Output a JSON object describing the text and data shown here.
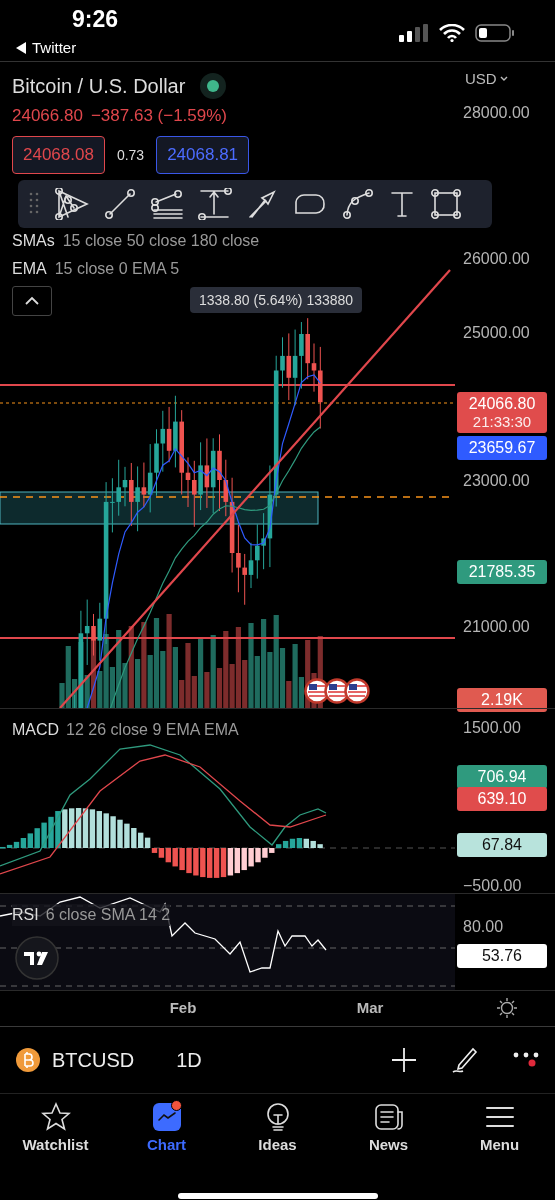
{
  "status_bar": {
    "time": "9:26",
    "back_label": "Twitter"
  },
  "symbol_header": {
    "title": "Bitcoin / U.S. Dollar",
    "last_price": "24066.80",
    "change": "−387.63 (−1.59%)",
    "bid": "24068.08",
    "spread": "0.73",
    "ask": "24068.81"
  },
  "indicators": [
    {
      "name": "SMAs",
      "params": "15 close 50 close 180 close"
    },
    {
      "name": "EMA",
      "params": "15 close 0 EMA 5"
    }
  ],
  "measure_tooltip": "1338.80 (5.64%) 133880",
  "price_axis": {
    "currency": "USD",
    "labels": [
      "28000.00",
      "26000.00",
      "25000.00",
      "23000.00",
      "21000.00"
    ],
    "tags": [
      {
        "kind": "last",
        "value": "24066.80",
        "timer": "21:33:30"
      },
      {
        "kind": "ema",
        "value": "23659.67"
      },
      {
        "kind": "sma",
        "value": "21785.35"
      },
      {
        "kind": "volume",
        "value": "2.19K"
      }
    ]
  },
  "macd": {
    "name": "MACD",
    "params": "12 26 close 9 EMA EMA",
    "axis_labels": [
      "1500.00",
      "−500.00"
    ],
    "tags": [
      {
        "kind": "macd",
        "value": "706.94"
      },
      {
        "kind": "signal",
        "value": "639.10"
      },
      {
        "kind": "histogram",
        "value": "67.84"
      }
    ]
  },
  "rsi": {
    "name": "RSI",
    "params": "6 close SMA 14 2",
    "axis_labels": [
      "80.00"
    ],
    "tags": [
      {
        "kind": "rsi",
        "value": "53.76"
      }
    ]
  },
  "time_axis": [
    "Feb",
    "Mar"
  ],
  "symbol_bar": {
    "symbol": "BTCUSD",
    "interval": "1D"
  },
  "tabs": [
    {
      "label": "Watchlist",
      "selected": false,
      "badge": false
    },
    {
      "label": "Chart",
      "selected": true,
      "badge": true
    },
    {
      "label": "Ideas",
      "selected": false,
      "badge": false
    },
    {
      "label": "News",
      "selected": false,
      "badge": false
    },
    {
      "label": "Menu",
      "selected": false,
      "badge": false
    }
  ]
}
